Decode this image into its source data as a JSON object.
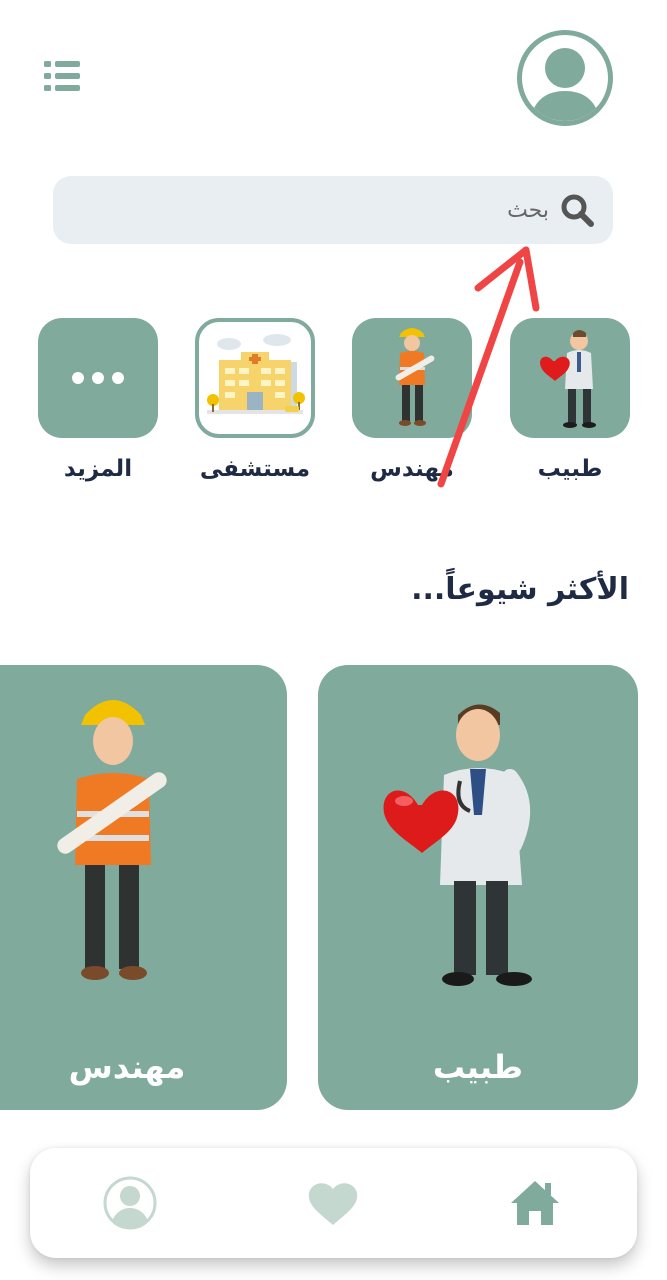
{
  "header": {
    "menu_icon": "list-icon",
    "profile_icon": "user-avatar-icon"
  },
  "search": {
    "placeholder": "بحث",
    "icon": "search-icon"
  },
  "categories": [
    {
      "label": "طبيب",
      "image": "doctor-illustration"
    },
    {
      "label": "مهندس",
      "image": "engineer-illustration"
    },
    {
      "label": "مستشفى",
      "image": "hospital-illustration"
    },
    {
      "label": "المزيد",
      "image": "more-dots-icon"
    }
  ],
  "popular": {
    "title": "الأكثر شيوعاً...",
    "cards": [
      {
        "label": "طبيب",
        "image": "doctor-illustration"
      },
      {
        "label": "مهندس",
        "image": "engineer-illustration"
      }
    ]
  },
  "bottom_nav": {
    "items": [
      {
        "icon": "home-icon",
        "active": true
      },
      {
        "icon": "heart-icon",
        "active": false
      },
      {
        "icon": "profile-icon",
        "active": false
      }
    ]
  },
  "colors": {
    "accent": "#7faa9c",
    "text_dark": "#1f2a44",
    "search_bg": "#e9eef2",
    "annotation_arrow": "#f04545",
    "nav_inactive": "#c4d8d0"
  }
}
